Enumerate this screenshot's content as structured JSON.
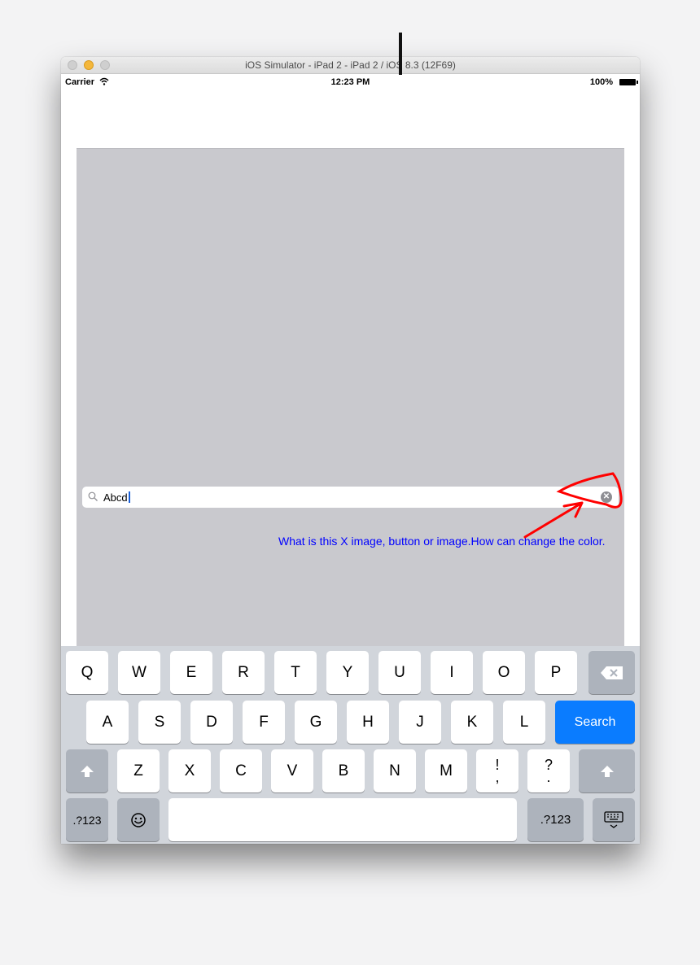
{
  "window": {
    "title": "iOS Simulator - iPad 2 - iPad 2 / iOS 8.3 (12F69)"
  },
  "statusbar": {
    "carrier": "Carrier",
    "time": "12:23 PM",
    "battery": "100%"
  },
  "search": {
    "value": "Abcd",
    "clear_icon": "clear-icon"
  },
  "annotation": {
    "text": "What is this X image, button or image.How can change the color.",
    "color": "#0000ff",
    "arrow_color": "#ff0000"
  },
  "keyboard": {
    "row1": [
      "Q",
      "W",
      "E",
      "R",
      "T",
      "Y",
      "U",
      "I",
      "O",
      "P"
    ],
    "row2": [
      "A",
      "S",
      "D",
      "F",
      "G",
      "H",
      "J",
      "K",
      "L"
    ],
    "search_label": "Search",
    "row3": [
      "Z",
      "X",
      "C",
      "V",
      "B",
      "N",
      "M"
    ],
    "punct1_top": "!",
    "punct1_bottom": ",",
    "punct2_top": "?",
    "punct2_bottom": ".",
    "numbers_left": ".?123",
    "numbers_right": ".?123",
    "accent": "#0a7cff"
  }
}
